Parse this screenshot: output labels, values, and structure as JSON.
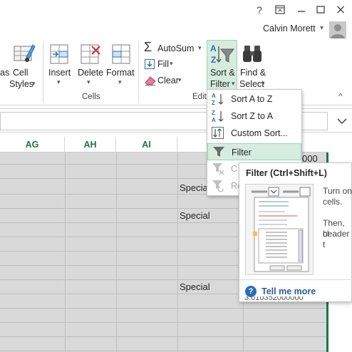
{
  "titlebar": {
    "help_glyph": "?",
    "ribbon_display_glyph": "⊡",
    "minimize_glyph": "—",
    "maximize_glyph": "☐",
    "close_glyph": "✕"
  },
  "user": {
    "name": "Calvin Morett",
    "dropdown_glyph": "▾"
  },
  "ribbon": {
    "styles_partial": "as",
    "cell_styles_line1": "Cell",
    "cell_styles_line2": "Styles",
    "insert_label": "Insert",
    "delete_label": "Delete",
    "format_label": "Format",
    "cells_group_label": "Cells",
    "editing_group_label": "Editi",
    "autosum_label": "AutoSum",
    "fill_label": "Fill",
    "clear_label": "Clear",
    "sort_filter_line1": "Sort &",
    "sort_filter_line2": "Filter",
    "find_select_line1": "Find &",
    "find_select_line2": "Select",
    "dropdown_glyph": "▾",
    "collapse_glyph": "^"
  },
  "menu": {
    "items": [
      {
        "label": "Sort A to Z",
        "enabled": true
      },
      {
        "label": "Sort Z to A",
        "enabled": true
      },
      {
        "label": "Custom Sort...",
        "enabled": true
      },
      {
        "label": "Filter",
        "enabled": true,
        "highlighted": true
      },
      {
        "label": "C",
        "enabled": false
      },
      {
        "label": "Re",
        "enabled": false
      }
    ]
  },
  "sheet": {
    "columns": [
      "AG",
      "AH",
      "AI",
      "A"
    ],
    "cells": [
      {
        "text": "Special"
      },
      {
        "text": "Special"
      },
      {
        "text": "Special"
      }
    ],
    "partial_number_top": "000",
    "partial_number_bottom": "3.010352000000"
  },
  "tooltip": {
    "title": "Filter (Ctrl+Shift+L)",
    "body_line1": "Turn on",
    "body_line2": "cells.",
    "body_line3": "Then, cl",
    "body_line4": "header t",
    "link_label": "Tell me more",
    "help_glyph": "?"
  },
  "colors": {
    "accent_green": "#217346",
    "menu_highlight": "#d5ecdf",
    "link_blue": "#2a5b9e",
    "grid_gray": "#d9d9d9"
  }
}
